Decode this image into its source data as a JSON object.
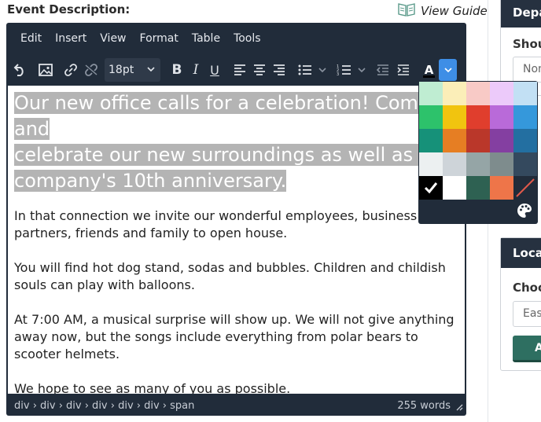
{
  "field_label": "Event Description:",
  "view_guide": {
    "label": "View Guide",
    "icon": "book-icon"
  },
  "menubar": [
    "Edit",
    "Insert",
    "View",
    "Format",
    "Table",
    "Tools"
  ],
  "toolbar": {
    "font_size": "18pt",
    "text_color_label": "A"
  },
  "content": {
    "headline_lines": [
      "Our new office calls for a celebration! Come and",
      "celebrate our new surroundings as well as the",
      "company's 10th anniversary."
    ],
    "paragraphs": [
      "In that connection we invite our wonderful employees, business partners, friends and family to open house.",
      "You will find hot dog stand, sodas and bubbles. Children and childish souls can play with balloons.",
      "At 7:00 AM, a musical surprise will show up. We will not give anything away now, but the songs include everything from polar bears to scooter helmets.",
      "We hope to see as many of you as possible."
    ]
  },
  "statusbar": {
    "path": "div › div › div › div › div › div › span",
    "word_count": "255 words"
  },
  "palette": {
    "colors": [
      [
        "#BFEDD2",
        "#FBEEB8",
        "#F8CAC6",
        "#ECCAFA",
        "#C2E0F4"
      ],
      [
        "#2DC26B",
        "#F1C40F",
        "#E03E2D",
        "#B96AD9",
        "#3598DB"
      ],
      [
        "#169179",
        "#E67E23",
        "#BA372A",
        "#843FA1",
        "#236FA1"
      ],
      [
        "#ECF0F1",
        "#CED4D9",
        "#95A5A6",
        "#7E8C8D",
        "#34495E"
      ],
      [
        "#000000",
        "#FFFFFF",
        "#2E6152",
        "#EE7549",
        "none"
      ]
    ],
    "selected": "#000000",
    "custom_icon": "palette-icon"
  },
  "side_panels": [
    {
      "title": "Depa",
      "label": "Shou",
      "input": "Non"
    },
    {
      "title": "Loca",
      "label": "Choo",
      "input": "Eas",
      "button": "A"
    }
  ]
}
